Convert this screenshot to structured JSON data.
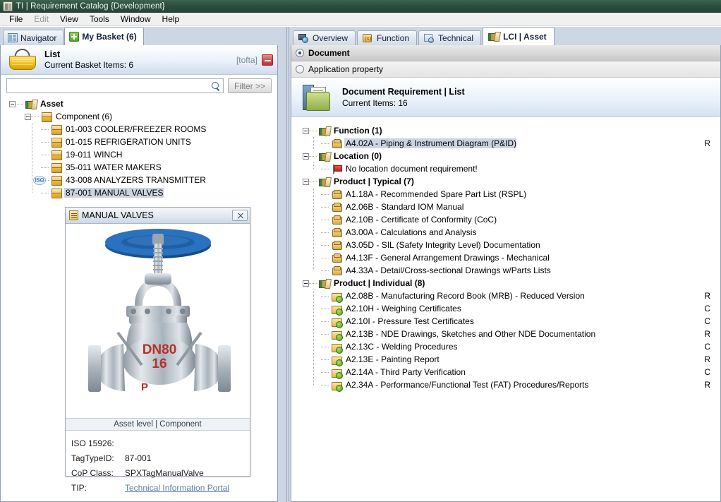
{
  "window": {
    "title": "TI | Requirement Catalog {Development}",
    "icon": "application-icon"
  },
  "menu": {
    "items": [
      {
        "label": "File",
        "disabled": false
      },
      {
        "label": "Edit",
        "disabled": true
      },
      {
        "label": "View",
        "disabled": false
      },
      {
        "label": "Tools",
        "disabled": false
      },
      {
        "label": "Window",
        "disabled": false
      },
      {
        "label": "Help",
        "disabled": false
      }
    ]
  },
  "left": {
    "tabs": [
      {
        "label": "Navigator",
        "icon": "navigator-icon",
        "active": false
      },
      {
        "label": "My Basket (6)",
        "icon": "plus-icon",
        "active": true
      }
    ],
    "header": {
      "title": "List",
      "subtitle": "Current Basket Items: 6",
      "user": "[tofta]",
      "icon": "basket-icon",
      "minimize_label": "minimize"
    },
    "search": {
      "value": "",
      "placeholder": "",
      "icon": "search-icon",
      "filter_label": "Filter >>"
    },
    "tree": [
      {
        "label": "Asset",
        "level": 0,
        "icon": "books-icon",
        "bold": true,
        "expander": true,
        "selected": false,
        "iso": false
      },
      {
        "label": "Component (6)",
        "level": 1,
        "icon": "box-icon",
        "bold": false,
        "expander": true,
        "selected": false,
        "iso": false
      },
      {
        "label": "01-003 COOLER/FREEZER ROOMS",
        "level": 2,
        "icon": "box-icon",
        "bold": false,
        "expander": false,
        "selected": false,
        "iso": false
      },
      {
        "label": "01-015 REFRIGERATION UNITS",
        "level": 2,
        "icon": "box-icon",
        "bold": false,
        "expander": false,
        "selected": false,
        "iso": false
      },
      {
        "label": "19-011 WINCH",
        "level": 2,
        "icon": "box-icon",
        "bold": false,
        "expander": false,
        "selected": false,
        "iso": false
      },
      {
        "label": "35-011 WATER MAKERS",
        "level": 2,
        "icon": "box-icon",
        "bold": false,
        "expander": false,
        "selected": false,
        "iso": false
      },
      {
        "label": "43-008 ANALYZERS TRANSMITTER",
        "level": 2,
        "icon": "box-icon",
        "bold": false,
        "expander": false,
        "selected": false,
        "iso": true
      },
      {
        "label": "87-001 MANUAL VALVES",
        "level": 2,
        "icon": "box-icon",
        "bold": false,
        "expander": false,
        "selected": true,
        "iso": false
      }
    ],
    "iso_badge_text": "ISO",
    "card": {
      "title": "MANUAL VALVES",
      "close_label": "close",
      "image": {
        "alt": "manual globe valve photo",
        "marking_1": "DN80",
        "marking_2": "16",
        "marking_3": "P"
      },
      "subtitle": "Asset level | Component",
      "fields": [
        {
          "key": "ISO 15926:",
          "value": "",
          "link": false
        },
        {
          "key": "TagTypeID:",
          "value": "87-001",
          "link": false
        },
        {
          "key": "CoP Class:",
          "value": "SPXTagManualValve",
          "link": false
        },
        {
          "key": "TIP:",
          "value": "Technical Information Portal",
          "link": true
        }
      ]
    }
  },
  "right": {
    "tabs": [
      {
        "label": "Overview",
        "icon": "overview-icon",
        "active": false
      },
      {
        "label": "Function",
        "icon": "function-icon",
        "active": false
      },
      {
        "label": "Technical",
        "icon": "technical-icon",
        "active": false
      },
      {
        "label": "LCI | Asset",
        "icon": "books-icon",
        "active": true
      }
    ],
    "radios": [
      {
        "label": "Document",
        "selected": true
      },
      {
        "label": "Application property",
        "selected": false
      }
    ],
    "header": {
      "title": "Document Requirement | List",
      "subtitle": "Current Items: 16",
      "icon": "folder-documents-icon"
    },
    "tree": [
      {
        "label": "Function (1)",
        "type": "group",
        "icon": "books-icon",
        "flag": "",
        "selected": false
      },
      {
        "label": "A4.02A - Piping & Instrument Diagram (P&ID)",
        "type": "doc",
        "icon": "document-icon",
        "flag": "R",
        "selected": true
      },
      {
        "label": "Location (0)",
        "type": "group",
        "icon": "books-icon",
        "flag": "",
        "selected": false
      },
      {
        "label": "No location document requirement!",
        "type": "note",
        "icon": "flag-icon",
        "flag": "",
        "selected": false
      },
      {
        "label": "Product | Typical (7)",
        "type": "group",
        "icon": "books-icon",
        "flag": "",
        "selected": false
      },
      {
        "label": "A1.18A - Recommended Spare Part List (RSPL)",
        "type": "doc",
        "icon": "document-icon",
        "flag": "",
        "selected": false
      },
      {
        "label": "A2.06B - Standard IOM Manual",
        "type": "doc",
        "icon": "document-icon",
        "flag": "",
        "selected": false
      },
      {
        "label": "A2.10B - Certificate of Conformity (CoC)",
        "type": "doc",
        "icon": "document-icon",
        "flag": "",
        "selected": false
      },
      {
        "label": "A3.00A - Calculations and Analysis",
        "type": "doc",
        "icon": "document-icon",
        "flag": "",
        "selected": false
      },
      {
        "label": "A3.05D - SIL (Safety Integrity Level) Documentation",
        "type": "doc",
        "icon": "document-icon",
        "flag": "",
        "selected": false
      },
      {
        "label": "A4.13F - General Arrangement Drawings - Mechanical",
        "type": "doc",
        "icon": "document-icon",
        "flag": "",
        "selected": false
      },
      {
        "label": "A4.33A - Detail/Cross-sectional Drawings w/Parts Lists",
        "type": "doc",
        "icon": "document-icon",
        "flag": "",
        "selected": false
      },
      {
        "label": "Product | Individual (8)",
        "type": "group",
        "icon": "books-icon",
        "flag": "",
        "selected": false
      },
      {
        "label": "A2.08B - Manufacturing Record Book (MRB) - Reduced Version",
        "type": "indiv",
        "icon": "folder-green-icon",
        "flag": "R",
        "selected": false
      },
      {
        "label": "A2.10H - Weighing Certificates",
        "type": "indiv",
        "icon": "folder-green-icon",
        "flag": "C",
        "selected": false
      },
      {
        "label": "A2.10I - Pressure Test Certificates",
        "type": "indiv",
        "icon": "folder-green-icon",
        "flag": "C",
        "selected": false
      },
      {
        "label": "A2.13B - NDE Drawings, Sketches and Other NDE Documentation",
        "type": "indiv",
        "icon": "folder-green-icon",
        "flag": "R",
        "selected": false
      },
      {
        "label": "A2.13C - Welding Procedures",
        "type": "indiv",
        "icon": "folder-green-icon",
        "flag": "C",
        "selected": false
      },
      {
        "label": "A2.13E - Painting Report",
        "type": "indiv",
        "icon": "folder-green-icon",
        "flag": "R",
        "selected": false
      },
      {
        "label": "A2.14A - Third Party Verification",
        "type": "indiv",
        "icon": "folder-green-icon",
        "flag": "C",
        "selected": false
      },
      {
        "label": "A2.34A - Performance/Functional Test (FAT) Procedures/Reports",
        "type": "indiv",
        "icon": "folder-green-icon",
        "flag": "R",
        "selected": false
      }
    ]
  },
  "colors": {
    "titlebar": "#2e4f3e",
    "workspace": "#ccd6e4",
    "selection": "#ccd4e0",
    "link": "#5a7fb0",
    "accent_yellow": "#f3c117",
    "flag_red": "#c41f12"
  }
}
